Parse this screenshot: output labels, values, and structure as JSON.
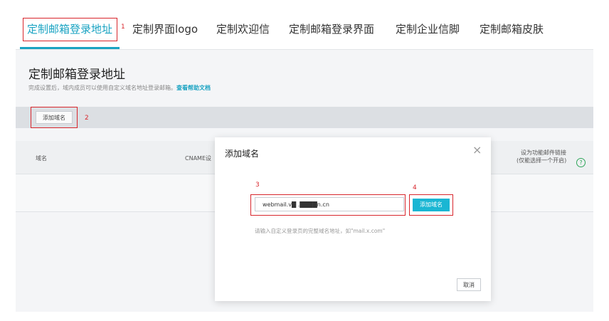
{
  "tabs": [
    {
      "label": "定制邮箱登录地址"
    },
    {
      "label": "定制界面logo"
    },
    {
      "label": "定制欢迎信"
    },
    {
      "label": "定制邮箱登录界面"
    },
    {
      "label": "定制企业信脚"
    },
    {
      "label": "定制邮箱皮肤"
    }
  ],
  "markers": {
    "m1": "1",
    "m2": "2",
    "m3": "3",
    "m4": "4"
  },
  "page": {
    "title": "定制邮箱登录地址",
    "description": "完成设置后，域内成员可以使用自定义域名地址登录邮箱。",
    "help_link": "查看帮助文档"
  },
  "toolbar": {
    "add_domain_label": "添加域名"
  },
  "table": {
    "col_domain": "域名",
    "col_cname": "CNAME设",
    "col_default_line1": "设为功能邮件链接",
    "col_default_line2": "(仅能选择一个开启)"
  },
  "dialog": {
    "title": "添加域名",
    "close_glyph": "×",
    "input_value": "webmail.v█ .████n.cn",
    "add_button": "添加域名",
    "hint": "请输入自定义登录页的完整域名地址，如\"mail.x.com\"",
    "cancel_button": "取消"
  },
  "colors": {
    "accent": "#1aa3c2",
    "primary_button": "#1ab6d3",
    "annotation": "#d8262c",
    "help_icon": "#2fa65a"
  },
  "icons": {
    "help": "question-circle-icon",
    "close": "close-icon"
  }
}
